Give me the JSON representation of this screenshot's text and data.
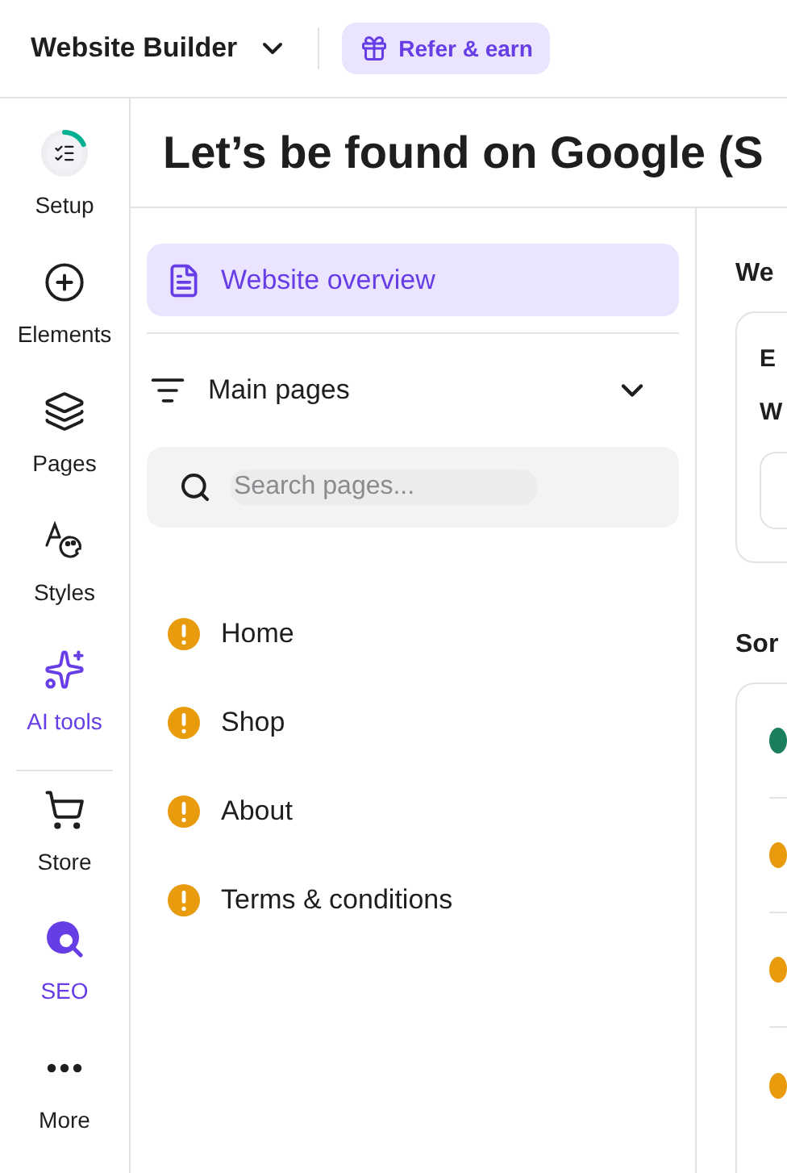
{
  "header": {
    "product": "Website Builder",
    "refer_button": "Refer & earn"
  },
  "sidebar": {
    "primary_items": [
      {
        "label": "Setup",
        "highlighted": false
      },
      {
        "label": "Elements",
        "highlighted": false
      },
      {
        "label": "Pages",
        "highlighted": false
      },
      {
        "label": "Styles",
        "highlighted": false
      },
      {
        "label": "AI tools",
        "highlighted": true
      }
    ],
    "secondary_items": [
      {
        "label": "Store",
        "highlighted": false
      },
      {
        "label": "SEO",
        "highlighted": true
      },
      {
        "label": "More",
        "highlighted": false
      }
    ]
  },
  "page_title": "Let’s be found on Google (S",
  "pages_panel": {
    "overview": {
      "label": "Website overview",
      "selected": true
    },
    "group": {
      "label": "Main pages",
      "expanded": true
    },
    "search": {
      "placeholder": "Search pages..."
    },
    "pages": [
      {
        "label": "Home"
      },
      {
        "label": "Shop"
      },
      {
        "label": "About"
      },
      {
        "label": "Terms & conditions"
      }
    ]
  },
  "detail_panel": {
    "section_1": {
      "heading": "We",
      "line_1": "E",
      "line_2": "W"
    },
    "section_2": {
      "heading": "Sor",
      "rows": [
        {
          "color": "#1a7f5a"
        },
        {
          "color": "#e89b0c"
        },
        {
          "color": "#e89b0c"
        },
        {
          "color": "#e89b0c"
        }
      ]
    }
  }
}
